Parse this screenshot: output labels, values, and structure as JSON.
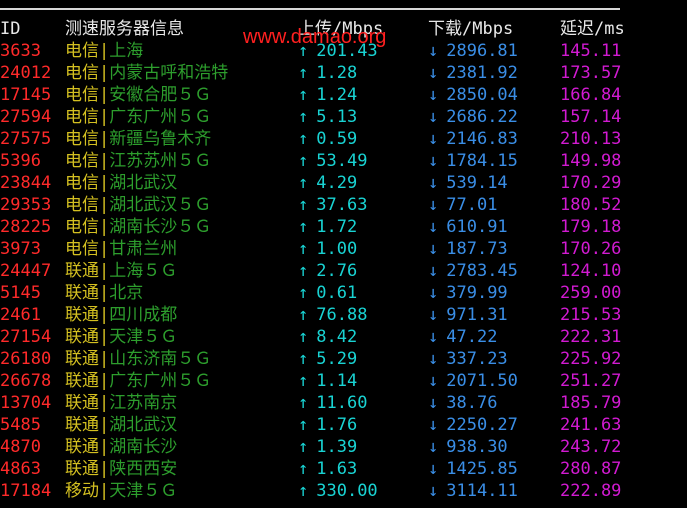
{
  "watermark": "www.damao.org",
  "header": {
    "id": "ID",
    "node": "测速服务器信息",
    "upload": "上传/Mbps",
    "download": "下载/Mbps",
    "latency": "延迟/ms"
  },
  "arrows": {
    "up": "↑",
    "down": "↓"
  },
  "separator": "|",
  "colors": {
    "id": "#ff2a2a",
    "isp": "#d4c021",
    "location": "#2d9e2d",
    "upload": "#19d3d3",
    "download": "#3a8ee6",
    "latency": "#d21ad2",
    "watermark": "#ff2020"
  },
  "rows": [
    {
      "id": "3633",
      "isp": "电信",
      "location": "上海",
      "upload": "201.43",
      "download": "2896.81",
      "latency": "145.11"
    },
    {
      "id": "24012",
      "isp": "电信",
      "location": "内蒙古呼和浩特",
      "upload": "1.28",
      "download": "2381.92",
      "latency": "173.57"
    },
    {
      "id": "17145",
      "isp": "电信",
      "location": "安徽合肥５Ｇ",
      "upload": "1.24",
      "download": "2850.04",
      "latency": "166.84"
    },
    {
      "id": "27594",
      "isp": "电信",
      "location": "广东广州５Ｇ",
      "upload": "5.13",
      "download": "2686.22",
      "latency": "157.14"
    },
    {
      "id": "27575",
      "isp": "电信",
      "location": "新疆乌鲁木齐",
      "upload": "0.59",
      "download": "2146.83",
      "latency": "210.13"
    },
    {
      "id": "5396",
      "isp": "电信",
      "location": "江苏苏州５Ｇ",
      "upload": "53.49",
      "download": "1784.15",
      "latency": "149.98"
    },
    {
      "id": "23844",
      "isp": "电信",
      "location": "湖北武汉",
      "upload": "4.29",
      "download": "539.14",
      "latency": "170.29"
    },
    {
      "id": "29353",
      "isp": "电信",
      "location": "湖北武汉５Ｇ",
      "upload": "37.63",
      "download": "77.01",
      "latency": "180.52"
    },
    {
      "id": "28225",
      "isp": "电信",
      "location": "湖南长沙５Ｇ",
      "upload": "1.72",
      "download": "610.91",
      "latency": "179.18"
    },
    {
      "id": "3973",
      "isp": "电信",
      "location": "甘肃兰州",
      "upload": "1.00",
      "download": "187.73",
      "latency": "170.26"
    },
    {
      "id": "24447",
      "isp": "联通",
      "location": "上海５Ｇ",
      "upload": "2.76",
      "download": "2783.45",
      "latency": "124.10"
    },
    {
      "id": "5145",
      "isp": "联通",
      "location": "北京",
      "upload": "0.61",
      "download": "379.99",
      "latency": "259.00"
    },
    {
      "id": "2461",
      "isp": "联通",
      "location": "四川成都",
      "upload": "76.88",
      "download": "971.31",
      "latency": "215.53"
    },
    {
      "id": "27154",
      "isp": "联通",
      "location": "天津５Ｇ",
      "upload": "8.42",
      "download": "47.22",
      "latency": "222.31"
    },
    {
      "id": "26180",
      "isp": "联通",
      "location": "山东济南５Ｇ",
      "upload": "5.29",
      "download": "337.23",
      "latency": "225.92"
    },
    {
      "id": "26678",
      "isp": "联通",
      "location": "广东广州５Ｇ",
      "upload": "1.14",
      "download": "2071.50",
      "latency": "251.27"
    },
    {
      "id": "13704",
      "isp": "联通",
      "location": "江苏南京",
      "upload": "11.60",
      "download": "38.76",
      "latency": "185.79"
    },
    {
      "id": "5485",
      "isp": "联通",
      "location": "湖北武汉",
      "upload": "1.76",
      "download": "2250.27",
      "latency": "241.63"
    },
    {
      "id": "4870",
      "isp": "联通",
      "location": "湖南长沙",
      "upload": "1.39",
      "download": "938.30",
      "latency": "243.72"
    },
    {
      "id": "4863",
      "isp": "联通",
      "location": "陕西西安",
      "upload": "1.63",
      "download": "1425.85",
      "latency": "280.87"
    },
    {
      "id": "17184",
      "isp": "移动",
      "location": "天津５Ｇ",
      "upload": "330.00",
      "download": "3114.11",
      "latency": "222.89"
    }
  ]
}
